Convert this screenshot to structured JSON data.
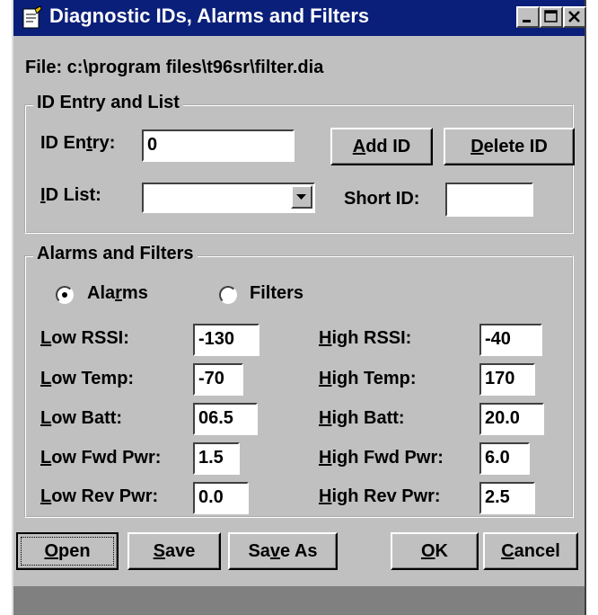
{
  "window": {
    "title": "Diagnostic IDs, Alarms and Filters",
    "controls": [
      "minimize-icon",
      "maximize-icon",
      "close-icon"
    ]
  },
  "file_label": "File:  c:\\program files\\t96sr\\filter.dia",
  "id_group": {
    "legend": "ID Entry and List",
    "id_entry": {
      "label_pre": "ID En",
      "label_mn": "t",
      "label_post": "ry:",
      "value": "0"
    },
    "add_id": {
      "mn": "A",
      "rest": "dd ID"
    },
    "delete_id": {
      "mn": "D",
      "rest": "elete ID"
    },
    "id_list": {
      "label_mn": "I",
      "label_rest": "D List:",
      "value": ""
    },
    "short_id": {
      "label": "Short ID:",
      "value": ""
    }
  },
  "alarms_group": {
    "legend": "Alarms and Filters",
    "mode": {
      "alarms_pre": "Ala",
      "alarms_mn": "r",
      "alarms_post": "ms",
      "filters": "Filters",
      "selected": "Alarms"
    },
    "rows": [
      {
        "low_mn": "L",
        "low_rest": "ow RSSI:",
        "low_value": "-130",
        "high_mn": "H",
        "high_rest": "igh RSSI:",
        "high_value": "-40"
      },
      {
        "low_mn": "L",
        "low_rest": "ow Temp:",
        "low_value": "-70",
        "high_mn": "H",
        "high_rest": "igh Temp:",
        "high_value": "170"
      },
      {
        "low_mn": "L",
        "low_rest": "ow Batt:",
        "low_value": "06.5",
        "high_mn": "H",
        "high_rest": "igh Batt:",
        "high_value": "20.0"
      },
      {
        "low_mn": "L",
        "low_rest": "ow Fwd Pwr:",
        "low_value": "1.5",
        "high_mn": "H",
        "high_rest": "igh Fwd Pwr:",
        "high_value": "6.0"
      },
      {
        "low_mn": "L",
        "low_rest": "ow Rev Pwr:",
        "low_value": "0.0",
        "high_mn": "H",
        "high_rest": "igh Rev Pwr:",
        "high_value": "2.5"
      }
    ]
  },
  "buttons": {
    "open": {
      "mn": "O",
      "rest": "pen"
    },
    "save": {
      "mn": "S",
      "rest": "ave"
    },
    "save_as": {
      "pre": "Sa",
      "mn": "v",
      "post": "e As"
    },
    "ok": {
      "mn": "O",
      "rest": "K"
    },
    "cancel": {
      "mn": "C",
      "rest": "ancel"
    }
  }
}
